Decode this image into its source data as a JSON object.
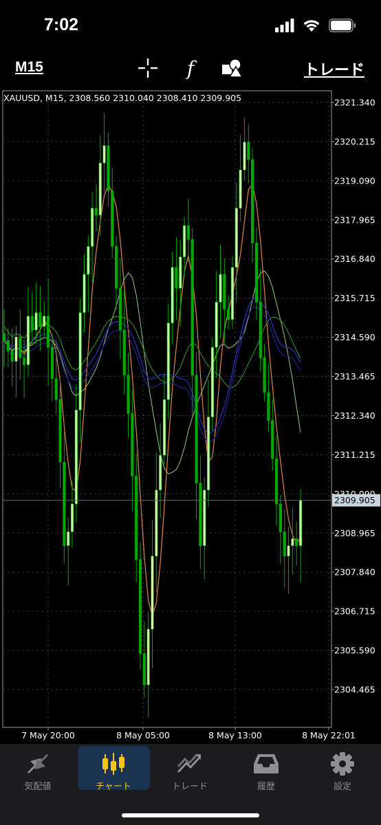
{
  "status": {
    "time": "7:02"
  },
  "toolbar": {
    "timeframe": "M15",
    "trade_label": "トレード"
  },
  "chart": {
    "info": "XAUUSD, M15, 2308.560 2310.040 2308.410 2309.905",
    "current_price": "2309.905",
    "price_labels": [
      "2321.340",
      "2320.215",
      "2319.090",
      "2317.965",
      "2316.840",
      "2315.715",
      "2314.590",
      "2313.465",
      "2312.340",
      "2311.215",
      "2310.090",
      "2308.965",
      "2307.840",
      "2306.715",
      "2305.590",
      "2304.465"
    ],
    "time_labels": [
      "7 May 20:00",
      "8 May 05:00",
      "8 May 13:00",
      "8 May 22:01"
    ],
    "colors": {
      "bull": "#ccffaa",
      "bear": "#00aa00",
      "grid": "#333333",
      "ma_orange": "#e0884a",
      "ma_green": "#2e9d2e",
      "ma_light": "#98c98a",
      "ma_blue": "#2a2aa8"
    }
  },
  "chart_data": {
    "type": "candlestick",
    "symbol": "XAUUSD",
    "timeframe": "M15",
    "ylim": [
      2303.7,
      2321.7
    ],
    "x_ticks": [
      "7 May 20:00",
      "8 May 05:00",
      "8 May 13:00",
      "8 May 22:01"
    ],
    "close_path": [
      2314.5,
      2314.2,
      2313.9,
      2314.6,
      2314.0,
      2313.8,
      2315.2,
      2314.8,
      2315.3,
      2314.9,
      2315.2,
      2314.3,
      2313.4,
      2312.8,
      2311.0,
      2308.6,
      2309.0,
      2309.8,
      2312.5,
      2315.3,
      2316.4,
      2317.2,
      2318.3,
      2318.1,
      2319.6,
      2320.1,
      2318.8,
      2317.2,
      2316.0,
      2314.8,
      2313.5,
      2312.4,
      2310.6,
      2308.2,
      2305.5,
      2304.6,
      2306.2,
      2308.3,
      2310.2,
      2311.2,
      2312.8,
      2315.0,
      2316.6,
      2316.0,
      2316.9,
      2317.8,
      2317.4,
      2313.5,
      2310.4,
      2308.6,
      2310.2,
      2312.3,
      2314.3,
      2315.6,
      2316.4,
      2315.4,
      2315.1,
      2316.6,
      2318.3,
      2319.4,
      2320.2,
      2319.7,
      2317.3,
      2315.6,
      2314.0,
      2313.0,
      2312.2,
      2311.1,
      2309.8,
      2309.0,
      2308.3,
      2308.6,
      2308.8,
      2308.6,
      2309.905
    ],
    "current": {
      "open": 2308.56,
      "high": 2310.04,
      "low": 2308.41,
      "close": 2309.905
    }
  },
  "tabs": [
    {
      "label": "気配値",
      "icon": "quotes-icon"
    },
    {
      "label": "チャート",
      "icon": "chart-candles-icon"
    },
    {
      "label": "トレード",
      "icon": "trade-icon"
    },
    {
      "label": "履歴",
      "icon": "history-inbox-icon"
    },
    {
      "label": "設定",
      "icon": "gear-icon"
    }
  ]
}
